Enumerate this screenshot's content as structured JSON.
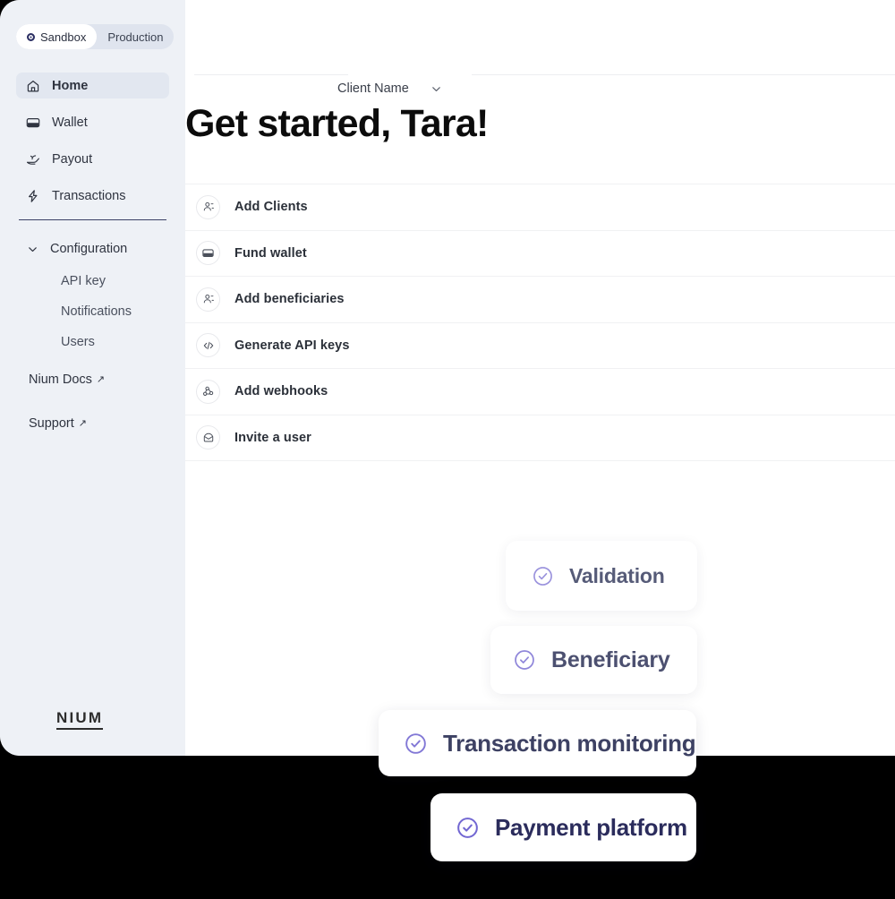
{
  "window": {
    "environment_toggle": {
      "options": [
        "Sandbox",
        "Production"
      ],
      "selected": "Sandbox",
      "sandbox_label": "Sandbox",
      "production_label": "Production"
    }
  },
  "sidebar": {
    "nav_items": [
      {
        "label": "Home",
        "icon": "home-icon",
        "active": true
      },
      {
        "label": "Wallet",
        "icon": "wallet-icon",
        "active": false
      },
      {
        "label": "Payout",
        "icon": "payout-icon",
        "active": false
      },
      {
        "label": "Transactions",
        "icon": "lightning-icon",
        "active": false
      }
    ],
    "configuration": {
      "label": "Configuration",
      "expanded": true,
      "chevron_icon": "chevron-down-icon",
      "sub_items": [
        {
          "label": "API key"
        },
        {
          "label": "Notifications"
        },
        {
          "label": "Users"
        }
      ]
    },
    "external_links": [
      {
        "label": "Nium Docs",
        "arrow": "↗"
      },
      {
        "label": "Support",
        "arrow": "↗"
      }
    ],
    "logo_text": "NIUM"
  },
  "main": {
    "client_selector": {
      "label": "Client Name",
      "chevron_icon": "chevron-down-icon"
    },
    "page_title": "Get started, Tara!",
    "checklist": [
      {
        "label": "Add Clients",
        "icon": "person-add-icon"
      },
      {
        "label": "Fund wallet",
        "icon": "wallet-icon"
      },
      {
        "label": "Add beneficiaries",
        "icon": "person-add-icon"
      },
      {
        "label": "Generate API keys",
        "icon": "code-icon"
      },
      {
        "label": "Add webhooks",
        "icon": "webhook-icon"
      },
      {
        "label": "Invite a user",
        "icon": "mail-user-icon"
      }
    ]
  },
  "feature_cards": [
    {
      "label": "Validation",
      "icon": "check-circle-icon"
    },
    {
      "label": "Beneficiary",
      "icon": "check-circle-icon"
    },
    {
      "label": "Transaction monitoring",
      "icon": "check-circle-icon"
    },
    {
      "label": "Payment platform",
      "icon": "check-circle-icon"
    }
  ],
  "colors": {
    "sidebar_bg": "#eef1f6",
    "main_bg": "#ffffff",
    "accent_purple": "#8b81d8",
    "nav_divider": "#3b4166",
    "title_text": "#0c0c0c",
    "page_outside": "#000000"
  }
}
